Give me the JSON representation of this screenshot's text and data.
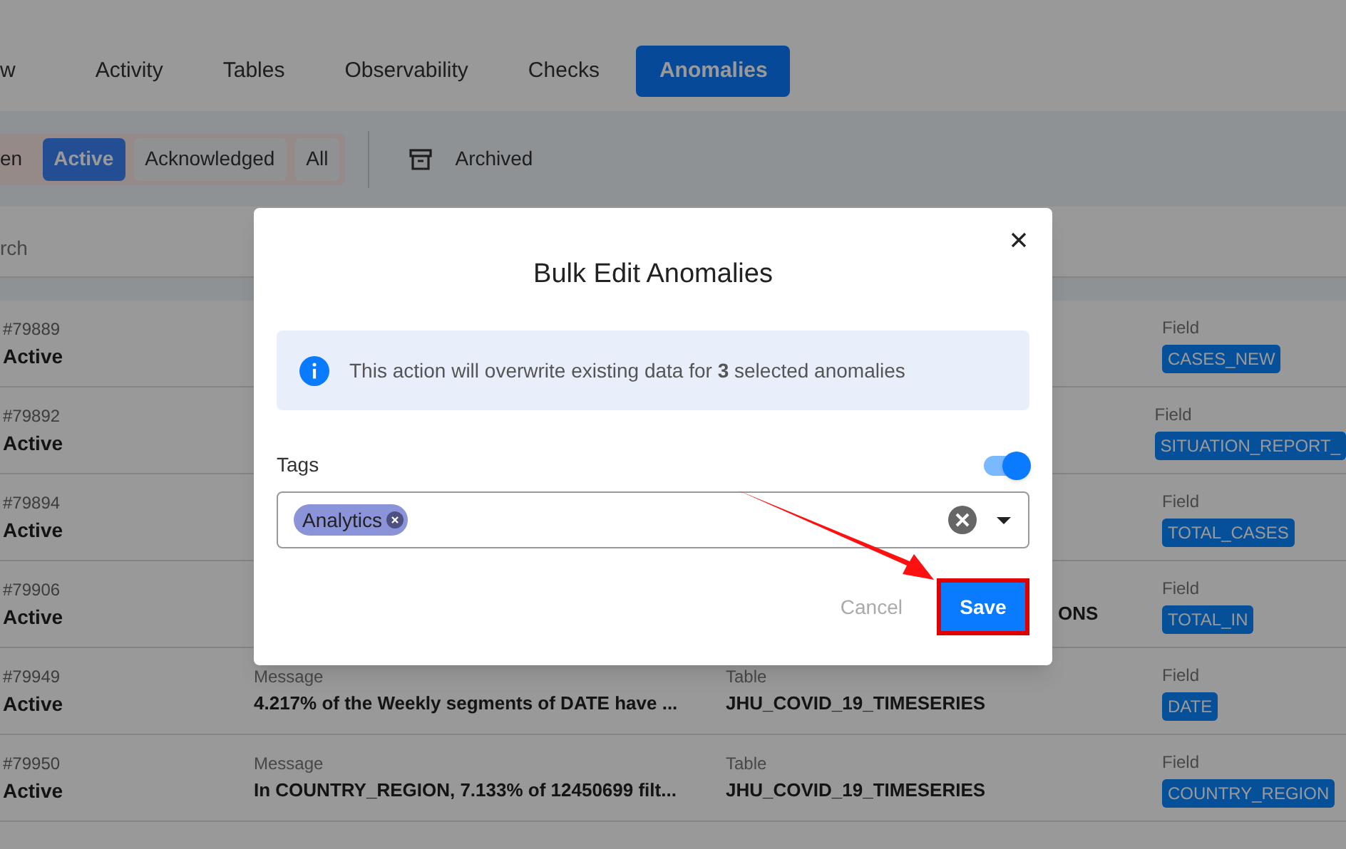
{
  "tabs": [
    {
      "label": "w",
      "selected": false
    },
    {
      "label": "Activity",
      "selected": false
    },
    {
      "label": "Tables",
      "selected": false
    },
    {
      "label": "Observability",
      "selected": false
    },
    {
      "label": "Checks",
      "selected": false
    },
    {
      "label": "Anomalies",
      "selected": true
    }
  ],
  "status_filters": [
    {
      "label": "en",
      "selected": false
    },
    {
      "label": "Active",
      "selected": true
    },
    {
      "label": "Acknowledged",
      "selected": false
    },
    {
      "label": "All",
      "selected": false
    }
  ],
  "archived": {
    "label": "Archived"
  },
  "search": {
    "placeholder": "rch"
  },
  "rows": [
    {
      "id": "#79889",
      "status": "Active",
      "field_label": "Field",
      "field": "CASES_NEW"
    },
    {
      "id": "#79892",
      "status": "Active",
      "field_label": "Field",
      "field": "SITUATION_REPORT_"
    },
    {
      "id": "#79894",
      "status": "Active",
      "field_label": "Field",
      "field": "TOTAL_CASES"
    },
    {
      "id": "#79906",
      "status": "Active",
      "table": "ONS",
      "field_label": "Field",
      "field": "TOTAL_IN"
    },
    {
      "id": "#79949",
      "status": "Active",
      "message_label": "Message",
      "message": "4.217% of the Weekly segments of DATE have ...",
      "table_label": "Table",
      "table": "JHU_COVID_19_TIMESERIES",
      "field_label": "Field",
      "field": "DATE"
    },
    {
      "id": "#79950",
      "status": "Active",
      "message_label": "Message",
      "message": "In COUNTRY_REGION, 7.133% of 12450699 filt...",
      "table_label": "Table",
      "table": "JHU_COVID_19_TIMESERIES",
      "field_label": "Field",
      "field": "COUNTRY_REGION"
    }
  ],
  "dialog": {
    "title": "Bulk Edit Anomalies",
    "notice": "This action will overwrite existing data for **3** selected anomalies",
    "tags_label": "Tags",
    "tags_toggle_on": true,
    "tags": [
      {
        "label": "Analytics"
      }
    ],
    "buttons": [
      {
        "label": "Cancel",
        "kind": "secondary"
      },
      {
        "label": "Save",
        "kind": "primary",
        "highlighted": true
      }
    ]
  }
}
